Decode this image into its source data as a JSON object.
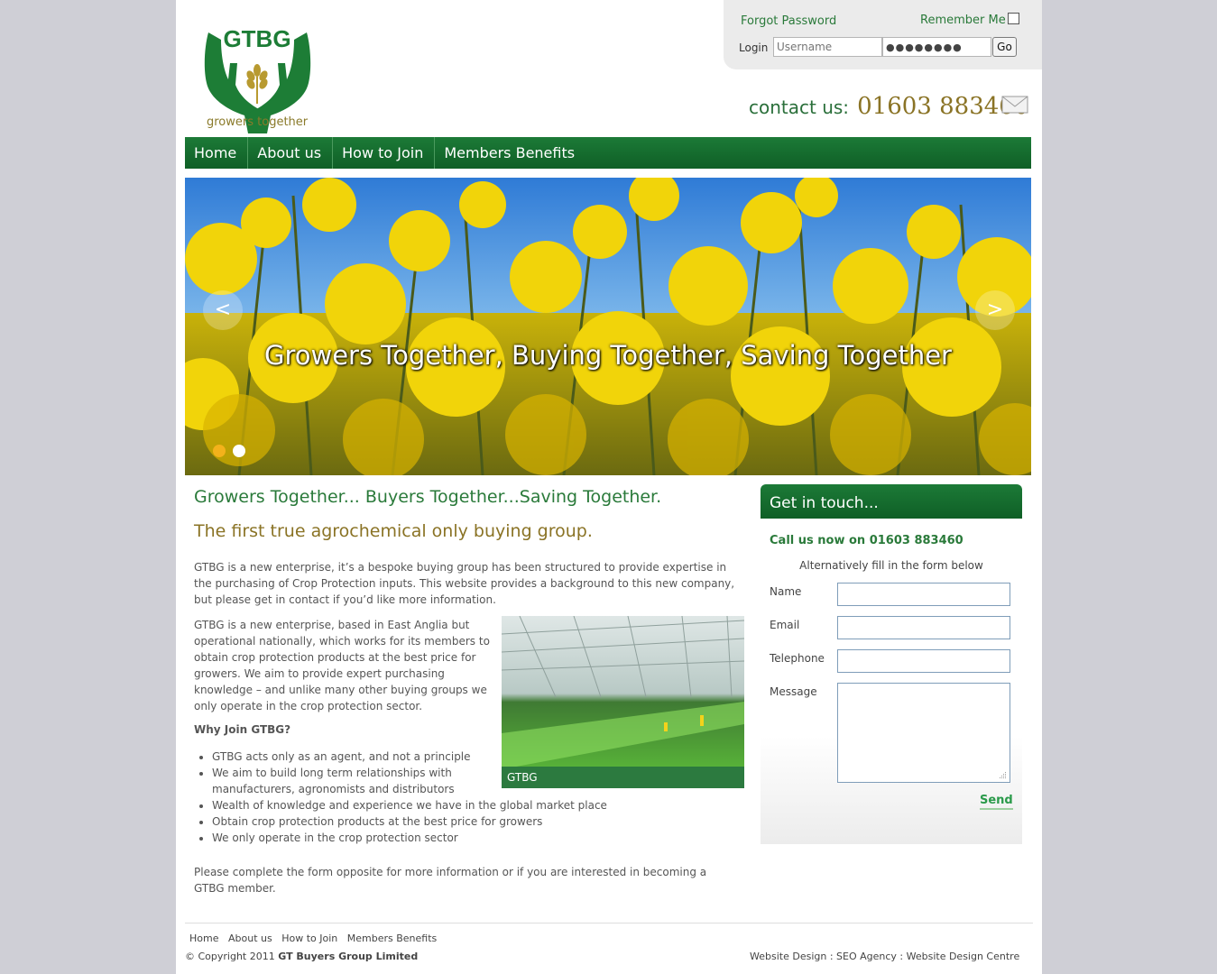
{
  "header": {
    "logo_text": "GTBG",
    "logo_tagline": "growers together",
    "forgot_password": "Forgot Password",
    "remember_me": "Remember Me",
    "login_label": "Login",
    "username_placeholder": "Username",
    "password_value": "●●●●●●●●",
    "go_label": "Go",
    "contact_label": "contact us:",
    "contact_phone": "01603 883460"
  },
  "nav": {
    "items": [
      "Home",
      "About us",
      "How to Join",
      "Members Benefits"
    ]
  },
  "hero": {
    "caption": "Growers Together, Buying Together, Saving Together",
    "prev": "<",
    "next": ">"
  },
  "main": {
    "heading": "Growers Together... Buyers Together...Saving Together.",
    "subheading": "The first true agrochemical only buying group.",
    "para1": "GTBG is a new enterprise, it’s a bespoke buying group has been structured to provide expertise in the purchasing of Crop Protection inputs. This website provides a background to this new company, but please get in contact if you’d like more information.",
    "para2": "GTBG is a new enterprise, based in East Anglia but operational nationally, which works for its members to obtain crop protection products at the best price for growers. We aim to provide expert purchasing knowledge – and unlike many other buying groups we only operate in the crop protection sector.",
    "photo_caption": "GTBG",
    "why_heading": "Why Join GTBG?",
    "bullets": [
      "GTBG acts only as an agent, and not a principle",
      "We aim to build long term relationships with manufacturers, agronomists and distributors",
      "Wealth of knowledge and experience we have in the global market place",
      "Obtain crop protection products at the best price for growers",
      "We only operate in the crop protection sector"
    ],
    "para3": "Please complete the form opposite for more information or if you are interested in becoming a GTBG member."
  },
  "form": {
    "title": "Get in touch...",
    "call_text": "Call us now on 01603 883460",
    "alt_text": "Alternatively fill in the form below",
    "name_label": "Name",
    "email_label": "Email",
    "telephone_label": "Telephone",
    "message_label": "Message",
    "send_label": "Send"
  },
  "footer": {
    "nav": [
      "Home",
      "About us",
      "How to Join",
      "Members Benefits"
    ],
    "copyright_prefix": "© Copyright 2011",
    "company": "GT Buyers Group Limited",
    "credits": "Website Design : SEO Agency : Website Design Centre"
  },
  "colors": {
    "brand_green": "#1c7a37",
    "brand_gold": "#8a7325",
    "accent_yellow": "#f3b21b"
  }
}
